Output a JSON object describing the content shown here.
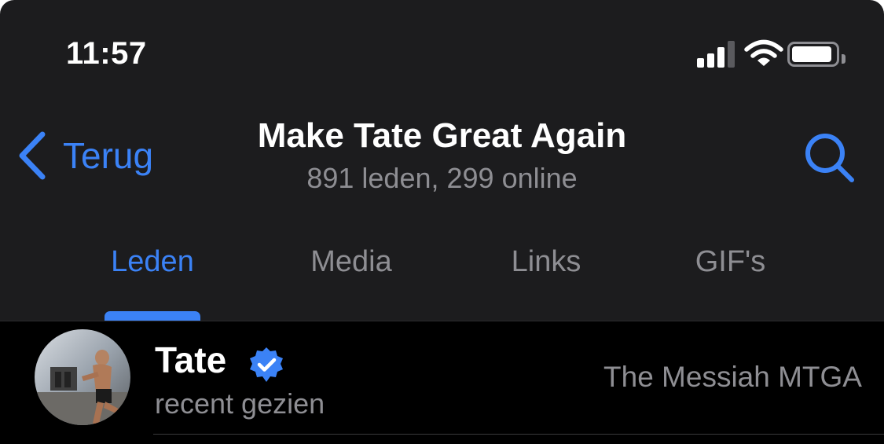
{
  "status_bar": {
    "time": "11:57",
    "battery_level": 0.92,
    "signal_bars_total": 4,
    "signal_bars_active": 3
  },
  "nav": {
    "back_label": "Terug",
    "title": "Make Tate Great Again",
    "subtitle": "891 leden, 299 online",
    "search_icon": "search-icon",
    "back_icon": "chevron-left-icon"
  },
  "tabs": [
    {
      "label": "Leden",
      "active": true
    },
    {
      "label": "Media",
      "active": false
    },
    {
      "label": "Links",
      "active": false
    },
    {
      "label": "GIF's",
      "active": false
    }
  ],
  "members": [
    {
      "name": "Tate",
      "verified": true,
      "status": "recent gezien",
      "role": "The Messiah MTGA"
    }
  ],
  "colors": {
    "accent": "#3b82f6",
    "background": "#1c1c1e",
    "list_background": "#000000",
    "secondary_text": "#8e8e93"
  }
}
